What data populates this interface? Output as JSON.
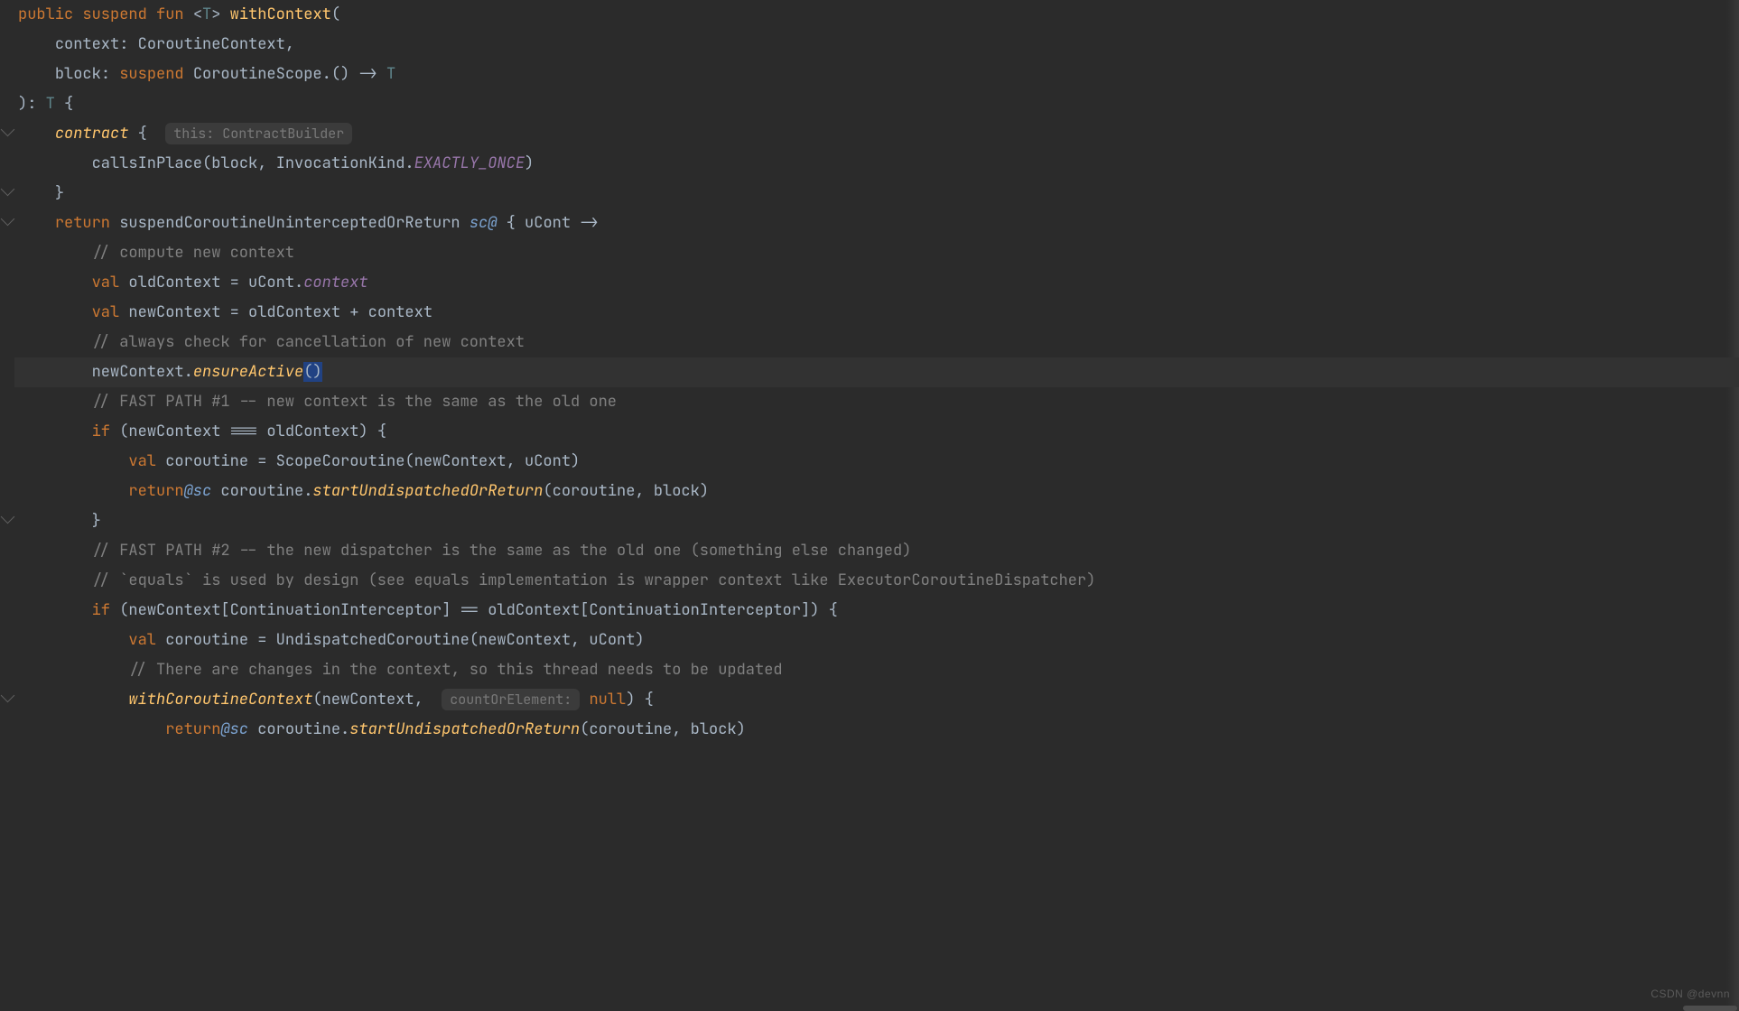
{
  "watermark": "CSDN @devnn",
  "hints": {
    "contract": "this: ContractBuilder",
    "countOrElement": "countOrElement:"
  },
  "tokens": {
    "public": "public",
    "suspend": "suspend",
    "fun": "fun",
    "T": "T",
    "withContext": "withContext",
    "open_paren": "(",
    "context_param": "context",
    "colon": ": ",
    "CoroutineContext": "CoroutineContext",
    "comma": ",",
    "block_param": "block",
    "CoroutineScope": "CoroutineScope",
    "arrow": ".() -> ",
    "close_sig": "): ",
    "brace_open": " {",
    "contract_kw": "contract",
    "brace_open2": " {",
    "callsInPlace": "callsInPlace",
    "block_ref": "(block, ",
    "InvocationKind": "InvocationKind.",
    "EXACTLY_ONCE": "EXACTLY_ONCE",
    "close_call": ")",
    "brace_close": "}",
    "return": "return",
    "suspendFn": "suspendCoroutineUninterceptedOrReturn",
    "label_sc": "sc@",
    "lambda_open": " { ",
    "uCont": "uCont",
    " ->": " ->",
    "cmt_compute": "// compute new context",
    "val": "val",
    "oldContext": "oldContext",
    "eq": " = ",
    "uCont_ref": "uCont.",
    "context_prop": "context",
    "newContext": "newContext",
    "plus": " = oldContext + context",
    "cmt_always": "// always check for cancellation of new context",
    "ensureActive": "ensureActive",
    "paren_sel": "()",
    "cmt_fp1": "// FAST PATH #1 -- new context is the same as the old one",
    "if": "if",
    "cond1": " (newContext === oldContext) {",
    "coroutine": "coroutine",
    "ScopeCoroutine": " = ScopeCoroutine(newContext, uCont)",
    "return_at": "return",
    "at_sc": "@sc",
    "coroutine_call": " coroutine.",
    "startUndispatched": "startUndispatchedOrReturn",
    "args1": "(coroutine, block)",
    "cmt_fp2": "// FAST PATH #2 -- the new dispatcher is the same as the old one (something else changed)",
    "cmt_equals": "// `equals` is used by design (see equals implementation is wrapper context like ExecutorCoroutineDispatcher)",
    "cond2": " (newContext[ContinuationInterceptor] == oldContext[ContinuationInterceptor]) {",
    "Undispatched": " = UndispatchedCoroutine(newContext, uCont)",
    "cmt_thread": "// There are changes in the context, so this thread needs to be updated",
    "withCorCtx": "withCoroutineContext",
    "wcc_open": "(newContext, ",
    "null": "null",
    "wcc_close": ") {"
  }
}
